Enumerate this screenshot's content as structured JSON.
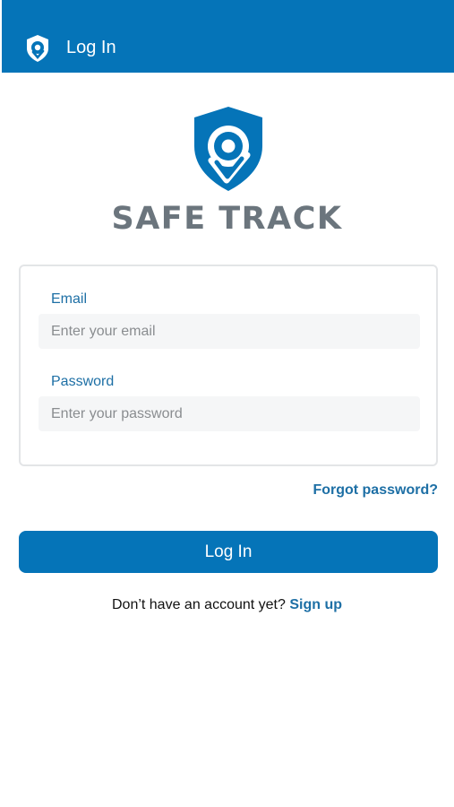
{
  "header": {
    "title": "Log In",
    "logo_icon": "safetrack-shield-icon"
  },
  "brand": {
    "name": "SAFE TRACK",
    "logo_icon": "safetrack-shield-logo"
  },
  "form": {
    "email_label": "Email",
    "email_placeholder": "Enter your email",
    "email_value": "",
    "password_label": "Password",
    "password_placeholder": "Enter your password",
    "password_value": ""
  },
  "forgot_password": "Forgot password?",
  "login_button": "Log In",
  "signup": {
    "prompt": "Don’t have an account yet?",
    "link": "Sign up"
  },
  "colors": {
    "primary": "#0574b8",
    "link": "#1d6fa5",
    "brand_text": "#6b757d",
    "input_bg": "#f5f6f7"
  }
}
